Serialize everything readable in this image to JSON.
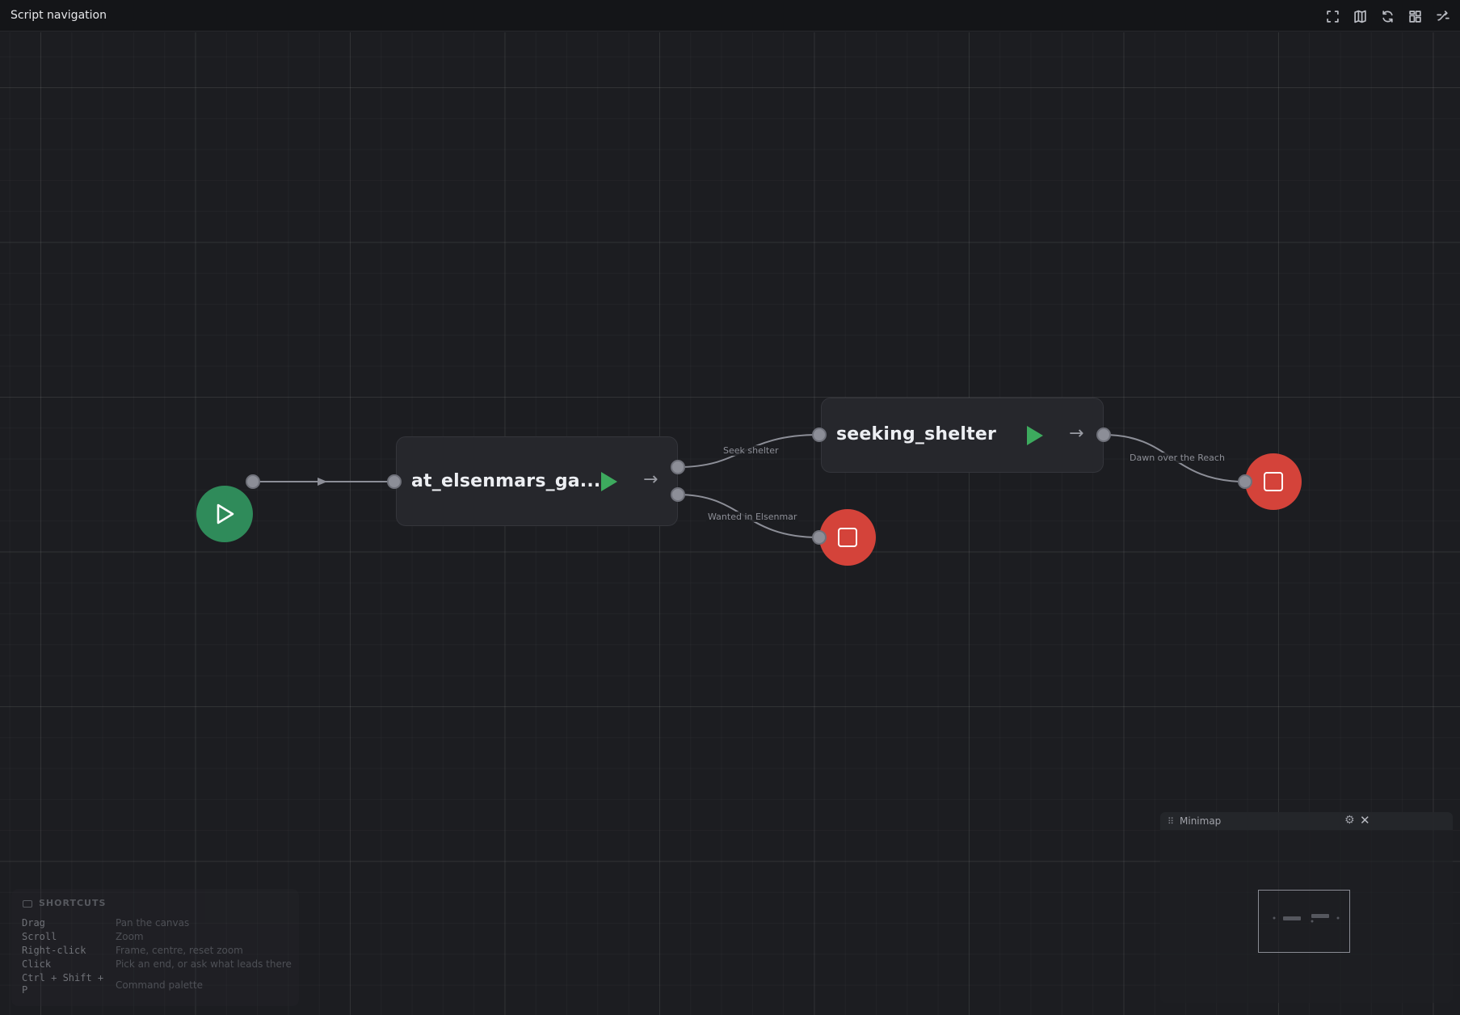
{
  "window": {
    "title": "Script navigation"
  },
  "toolbar": {
    "icons": [
      "fullscreen-icon",
      "map-icon",
      "refresh-icon",
      "layout-icon",
      "route-icon"
    ]
  },
  "nodes": {
    "start": {
      "kind": "start",
      "icon": "play-outline-icon"
    },
    "scene_a": {
      "label": "at_elsenmars_ga..."
    },
    "scene_b": {
      "label": "seeking_shelter"
    },
    "end_wanted": {
      "kind": "end"
    },
    "end_dawn": {
      "kind": "end"
    }
  },
  "edges": [
    {
      "from": "start",
      "to": "scene_a",
      "label": ""
    },
    {
      "from": "scene_a",
      "to": "scene_b",
      "label": "Seek shelter"
    },
    {
      "from": "scene_a",
      "to": "end_wanted",
      "label": "Wanted in Elsenmar"
    },
    {
      "from": "scene_b",
      "to": "end_dawn",
      "label": "Dawn over the Reach"
    }
  ],
  "shortcuts": {
    "title": "SHORTCUTS",
    "items": [
      {
        "key": "Drag",
        "desc": "Pan the canvas"
      },
      {
        "key": "Scroll",
        "desc": "Zoom"
      },
      {
        "key": "Right-click",
        "desc": "Frame, centre, reset zoom"
      },
      {
        "key": "Click",
        "desc": "Pick an end, or ask what leads there"
      },
      {
        "key": "Ctrl + Shift + P",
        "desc": "Command palette"
      }
    ]
  },
  "minimap": {
    "title": "Minimap"
  },
  "colors": {
    "start": "#2f8b5a",
    "end": "#d4433a",
    "play": "#3daa5e",
    "node_bg": "#26272c"
  }
}
